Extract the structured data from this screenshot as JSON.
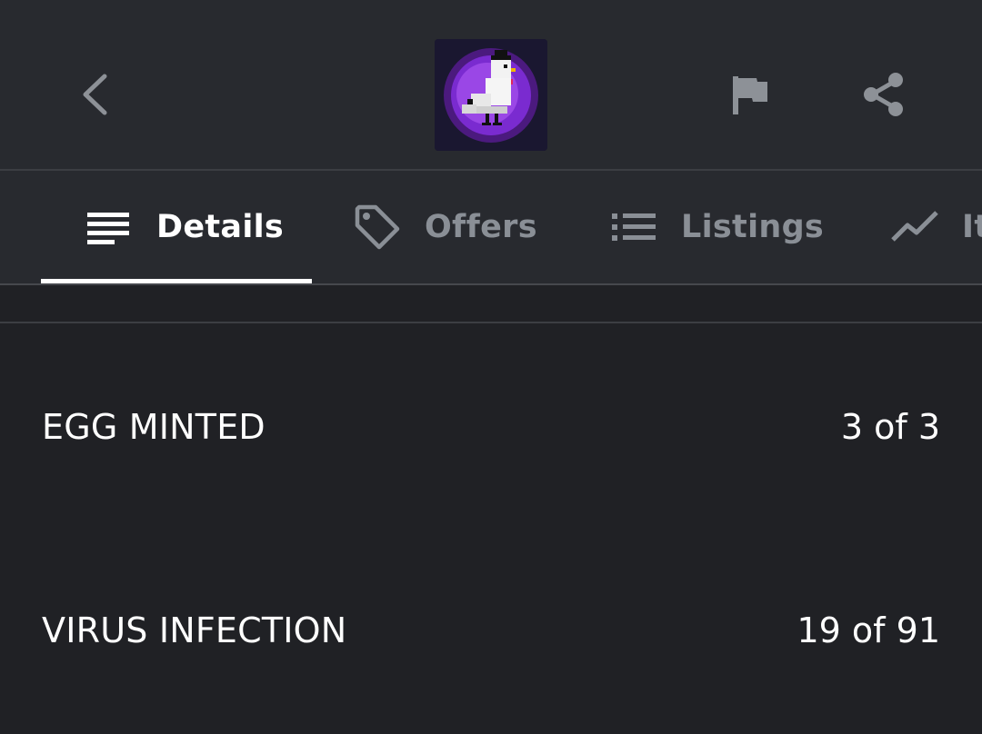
{
  "header": {
    "back_icon": "chevron-left-icon",
    "avatar_alt": "pixel-pigeon-avatar",
    "flag_icon": "flag-icon",
    "share_icon": "share-icon",
    "colors": {
      "avatar_ring": "#7a2bd0",
      "avatar_bg": "#1a1730"
    }
  },
  "tabs": [
    {
      "label": "Details",
      "icon": "notes-icon",
      "active": true
    },
    {
      "label": "Offers",
      "icon": "tag-icon",
      "active": false
    },
    {
      "label": "Listings",
      "icon": "list-icon",
      "active": false
    },
    {
      "label": "It",
      "icon": "trending-icon",
      "active": false
    }
  ],
  "properties": [
    {
      "key": "EGG MINTED",
      "value": "3 of 3"
    },
    {
      "key": "VIRUS INFECTION",
      "value": "19 of 91"
    }
  ]
}
